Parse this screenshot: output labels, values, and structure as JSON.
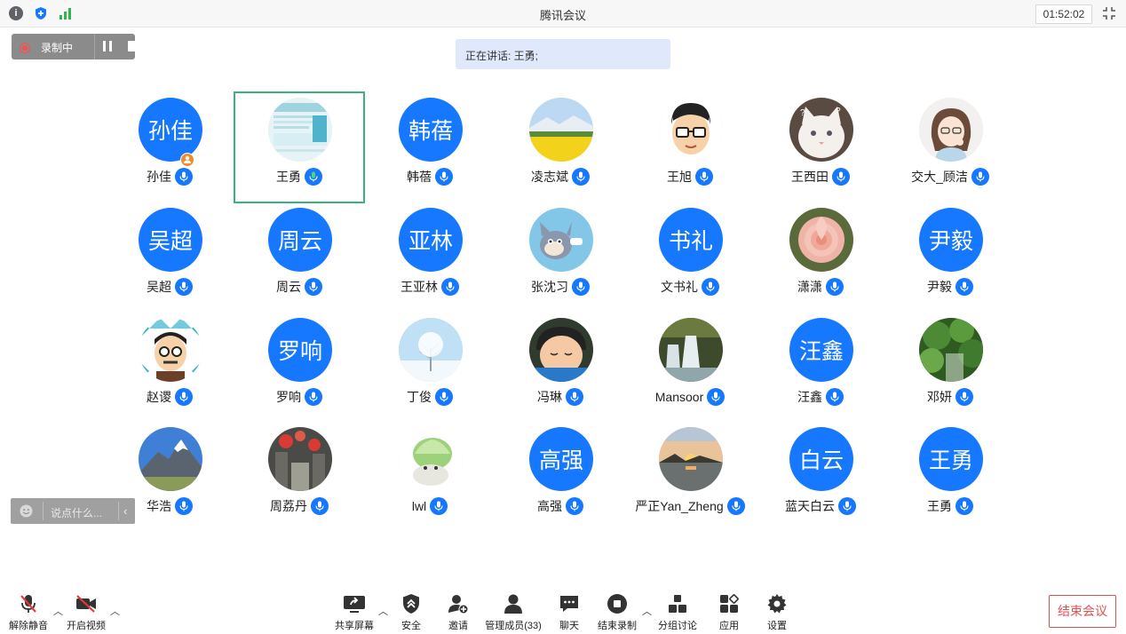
{
  "window": {
    "title": "腾讯会议",
    "timer": "01:52:02"
  },
  "recording": {
    "label": "录制中"
  },
  "speaking": {
    "text": "正在讲话: 王勇;"
  },
  "chat": {
    "placeholder": "说点什么..."
  },
  "participants": [
    {
      "name": "孙佳",
      "avatar_text": "孙佳",
      "avatar_type": "text",
      "host": true
    },
    {
      "name": "王勇",
      "avatar_type": "image",
      "image": "schedule-screenshot",
      "active": true,
      "talking": true
    },
    {
      "name": "韩蓓",
      "avatar_text": "韩蓓",
      "avatar_type": "text"
    },
    {
      "name": "凌志斌",
      "avatar_type": "image",
      "image": "rapeseed-field"
    },
    {
      "name": "王旭",
      "avatar_type": "image",
      "image": "cartoon-man-glasses"
    },
    {
      "name": "王西田",
      "avatar_type": "image",
      "image": "white-cat"
    },
    {
      "name": "交大_顾洁",
      "avatar_type": "image",
      "image": "cartoon-woman"
    },
    {
      "name": "吴超",
      "avatar_text": "吴超",
      "avatar_type": "text"
    },
    {
      "name": "周云",
      "avatar_text": "周云",
      "avatar_type": "text"
    },
    {
      "name": "王亚林",
      "avatar_text": "亚林",
      "avatar_type": "text"
    },
    {
      "name": "张沈习",
      "avatar_type": "image",
      "image": "cartoon-cat-tom"
    },
    {
      "name": "文书礼",
      "avatar_text": "书礼",
      "avatar_type": "text"
    },
    {
      "name": "潇潇",
      "avatar_type": "image",
      "image": "pink-rose"
    },
    {
      "name": "尹毅",
      "avatar_text": "尹毅",
      "avatar_type": "text"
    },
    {
      "name": "赵谡",
      "avatar_type": "image",
      "image": "cartoon-man-diamond"
    },
    {
      "name": "罗响",
      "avatar_text": "罗响",
      "avatar_type": "text"
    },
    {
      "name": "丁俊",
      "avatar_type": "image",
      "image": "snow-tree"
    },
    {
      "name": "冯琳",
      "avatar_type": "image",
      "image": "sleeping-child"
    },
    {
      "name": "Mansoor",
      "avatar_type": "image",
      "image": "waterfall"
    },
    {
      "name": "汪鑫",
      "avatar_text": "汪鑫",
      "avatar_type": "text"
    },
    {
      "name": "邓妍",
      "avatar_type": "image",
      "image": "green-hills"
    },
    {
      "name": "华浩",
      "avatar_type": "image",
      "image": "mountain"
    },
    {
      "name": "周荔丹",
      "avatar_type": "image",
      "image": "red-lanterns-street"
    },
    {
      "name": "lwl",
      "avatar_type": "image",
      "image": "cabbage-dog"
    },
    {
      "name": "高强",
      "avatar_text": "高强",
      "avatar_type": "text"
    },
    {
      "name": "严正Yan_Zheng",
      "avatar_type": "image",
      "image": "sunset-lake"
    },
    {
      "name": "蓝天白云",
      "avatar_text": "白云",
      "avatar_type": "text"
    },
    {
      "name": "王勇",
      "avatar_text": "王勇",
      "avatar_type": "text"
    }
  ],
  "toolbar": {
    "unmute": "解除静音",
    "start_video": "开启视频",
    "share_screen": "共享屏幕",
    "security": "安全",
    "invite": "邀请",
    "manage_members": "管理成员(33)",
    "chat": "聊天",
    "end_recording": "结束录制",
    "breakout": "分组讨论",
    "apps": "应用",
    "settings": "设置",
    "end_meeting": "结束会议"
  },
  "colors": {
    "avatar_blue": "#1677ff",
    "active_border": "#36b37e",
    "end_red": "#e05050"
  }
}
